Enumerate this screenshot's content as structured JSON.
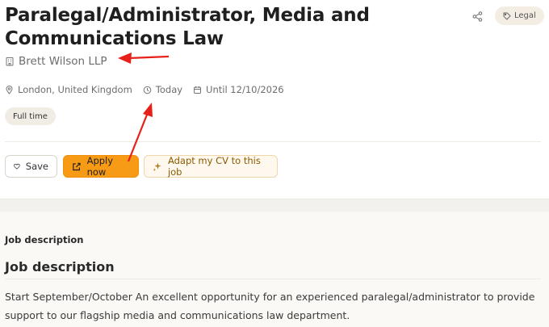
{
  "job": {
    "title": "Paralegal/Administrator, Media and Communications Law",
    "company": "Brett Wilson LLP",
    "location": "London, United Kingdom",
    "posted": "Today",
    "until": "Until 12/10/2026",
    "employment_type": "Full time",
    "category_tag": "Legal"
  },
  "actions": {
    "save_label": "Save",
    "apply_label": "Apply now",
    "adapt_cv_label": "Adapt my CV to this job"
  },
  "description": {
    "section_label": "Job description",
    "heading": "Job description",
    "text": "Start September/October An excellent opportunity for an experienced paralegal/administrator to provide support to our flagship media and communications law department."
  },
  "colors": {
    "accent": "#f79a16",
    "annotation_arrow": "#e8201a"
  }
}
